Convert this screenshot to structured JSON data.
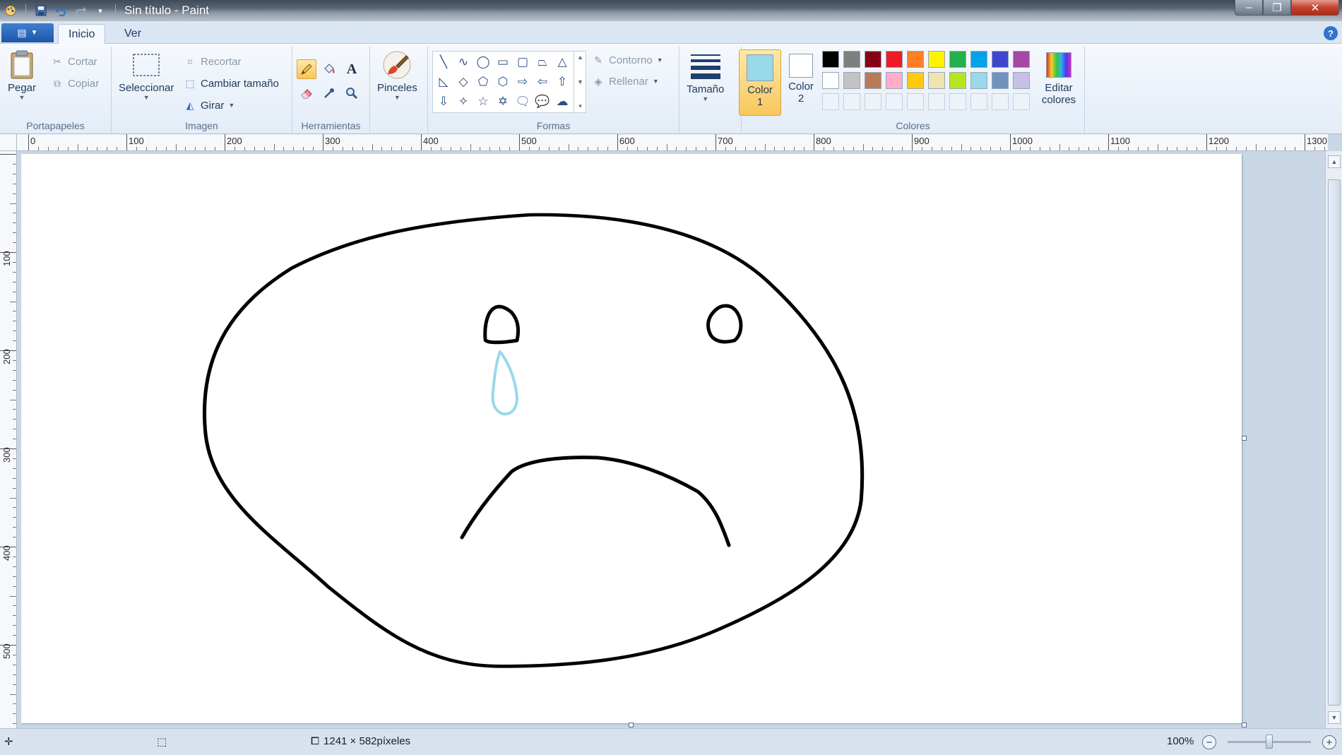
{
  "window": {
    "title": "Sin título - Paint",
    "controls": {
      "minimize": "–",
      "maximize": "❐",
      "close": "✕"
    }
  },
  "quick_access": {
    "app_icon": "paint-app-icon",
    "save_icon": "save-icon",
    "undo_icon": "undo-icon",
    "redo_icon": "redo-icon",
    "customize_icon": "chevron-down-icon"
  },
  "tabs": {
    "app_menu_icon": "menu-icon",
    "home": "Inicio",
    "view": "Ver",
    "help": "?"
  },
  "ribbon": {
    "clipboard": {
      "label": "Portapapeles",
      "paste": "Pegar",
      "cut": "Cortar",
      "copy": "Copiar"
    },
    "image": {
      "label": "Imagen",
      "select": "Seleccionar",
      "crop": "Recortar",
      "resize": "Cambiar tamaño",
      "rotate": "Girar"
    },
    "tools": {
      "label": "Herramientas",
      "brushes": "Pinceles",
      "text_glyph": "A"
    },
    "shapes": {
      "label": "Formas",
      "outline": "Contorno",
      "fill": "Rellenar"
    },
    "size": {
      "label": "Tamaño"
    },
    "colors": {
      "label": "Colores",
      "color1_line1": "Color",
      "color1_line2": "1",
      "color2_line1": "Color",
      "color2_line2": "2",
      "edit_line1": "Editar",
      "edit_line2": "colores",
      "color1_value": "#99d9ea",
      "color2_value": "#ffffff",
      "palette_row1": [
        "#000000",
        "#7f7f7f",
        "#880015",
        "#ed1c24",
        "#ff7f27",
        "#fff200",
        "#22b14c",
        "#00a2e8",
        "#3f48cc",
        "#a349a4"
      ],
      "palette_row2": [
        "#ffffff",
        "#c3c3c3",
        "#b97a57",
        "#ffaec9",
        "#ffc90e",
        "#efe4b0",
        "#b5e61d",
        "#99d9ea",
        "#7092be",
        "#c8bfe7"
      ]
    }
  },
  "ruler": {
    "top_labels": [
      "0",
      "100",
      "200",
      "300",
      "400",
      "500",
      "600",
      "700",
      "800",
      "900",
      "1000",
      "1100",
      "1200",
      "1300"
    ],
    "left_labels": [
      "100",
      "200",
      "300",
      "400",
      "500"
    ]
  },
  "drawing": {
    "face_color": "#000000",
    "tear_color": "#99d9ea"
  },
  "status": {
    "image_size": "1241 × 582píxeles",
    "zoom": "100%",
    "zoom_out": "−",
    "zoom_in": "+"
  }
}
